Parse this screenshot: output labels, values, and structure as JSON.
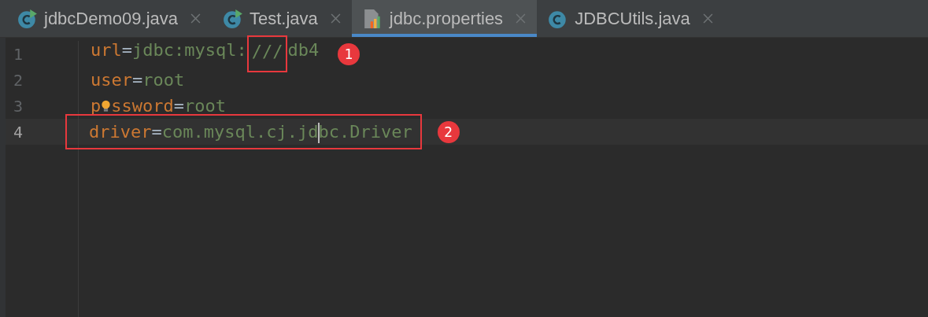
{
  "tabs": [
    {
      "label": "jdbcDemo09.java",
      "kind": "runnable-class",
      "selected": false
    },
    {
      "label": "Test.java",
      "kind": "runnable-class",
      "selected": false
    },
    {
      "label": "jdbc.properties",
      "kind": "properties",
      "selected": true
    },
    {
      "label": "JDBCUtils.java",
      "kind": "class",
      "selected": false
    }
  ],
  "editor": {
    "lines": [
      {
        "number": "1",
        "current": false,
        "boxed": false,
        "badge": "1",
        "tokens": [
          {
            "text": "url",
            "kind": "key"
          },
          {
            "text": "=",
            "kind": "sep"
          },
          {
            "text": "jdbc:mysql:",
            "kind": "value"
          },
          {
            "text": "///",
            "kind": "value",
            "boxed": true
          },
          {
            "text": "db4",
            "kind": "value"
          }
        ]
      },
      {
        "number": "2",
        "current": false,
        "boxed": false,
        "tokens": [
          {
            "text": "user",
            "kind": "key"
          },
          {
            "text": "=",
            "kind": "sep"
          },
          {
            "text": "root",
            "kind": "value"
          }
        ]
      },
      {
        "number": "3",
        "current": false,
        "boxed": false,
        "tokens": [
          {
            "text": "p",
            "kind": "key"
          },
          {
            "kind": "bulb"
          },
          {
            "text": "ssword",
            "kind": "key"
          },
          {
            "text": "=",
            "kind": "sep"
          },
          {
            "text": "root",
            "kind": "value"
          }
        ]
      },
      {
        "number": "4",
        "current": true,
        "boxed": true,
        "badge": "2",
        "tokens": [
          {
            "text": "driver",
            "kind": "key"
          },
          {
            "text": "=",
            "kind": "sep"
          },
          {
            "text": "com.mysql.cj.jd",
            "kind": "value"
          },
          {
            "text": "bc.Driver",
            "kind": "value",
            "caret": true
          }
        ]
      }
    ]
  }
}
